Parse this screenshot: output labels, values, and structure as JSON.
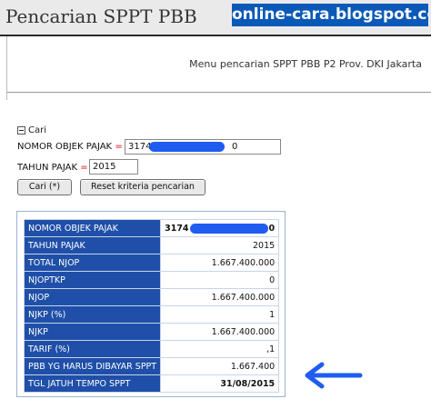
{
  "header": {
    "title": "Pencarian SPPT PBB",
    "watermark": "online-cara.blogspot.com",
    "subtitle": "Menu pencarian SPPT PBB P2 Prov. DKI Jakarta"
  },
  "search": {
    "toggle_label": "Cari",
    "nop_label": "NOMOR OBJEK PAJAK",
    "nop_value_prefix": "3174",
    "nop_value_suffix": "0",
    "tahun_label": "TAHUN PAJAK",
    "tahun_value": "2015",
    "required_mark": "=",
    "cari_button": "Cari (*)",
    "reset_button": "Reset kriteria pencarian"
  },
  "results": {
    "rows": [
      {
        "label": "NOMOR OBJEK PAJAK",
        "value_prefix": "3174",
        "value_suffix": "0"
      },
      {
        "label": "TAHUN PAJAK",
        "value": "2015"
      },
      {
        "label": "TOTAL NJOP",
        "value": "1.667.400.000"
      },
      {
        "label": "NJOPTKP",
        "value": "0"
      },
      {
        "label": "NJOP",
        "value": "1.667.400.000"
      },
      {
        "label": "NJKP (%)",
        "value": "1"
      },
      {
        "label": "NJKP",
        "value": "1.667.400.000"
      },
      {
        "label": "TARIF (%)",
        "value": ",1"
      },
      {
        "label": "PBB YG HARUS DIBAYAR SPPT",
        "value": "1.667.400"
      },
      {
        "label": "TGL JATUH TEMPO SPPT",
        "value": "31/08/2015"
      }
    ]
  },
  "colors": {
    "table_key_bg": "#1f4fa8",
    "watermark_bg": "#0a59b8",
    "redaction": "#1f5cf0",
    "arrow": "#1f5cf0",
    "required": "#d40000"
  },
  "icons": {
    "toggle": "collapse-minus-icon",
    "pointer": "arrow-left-icon"
  }
}
